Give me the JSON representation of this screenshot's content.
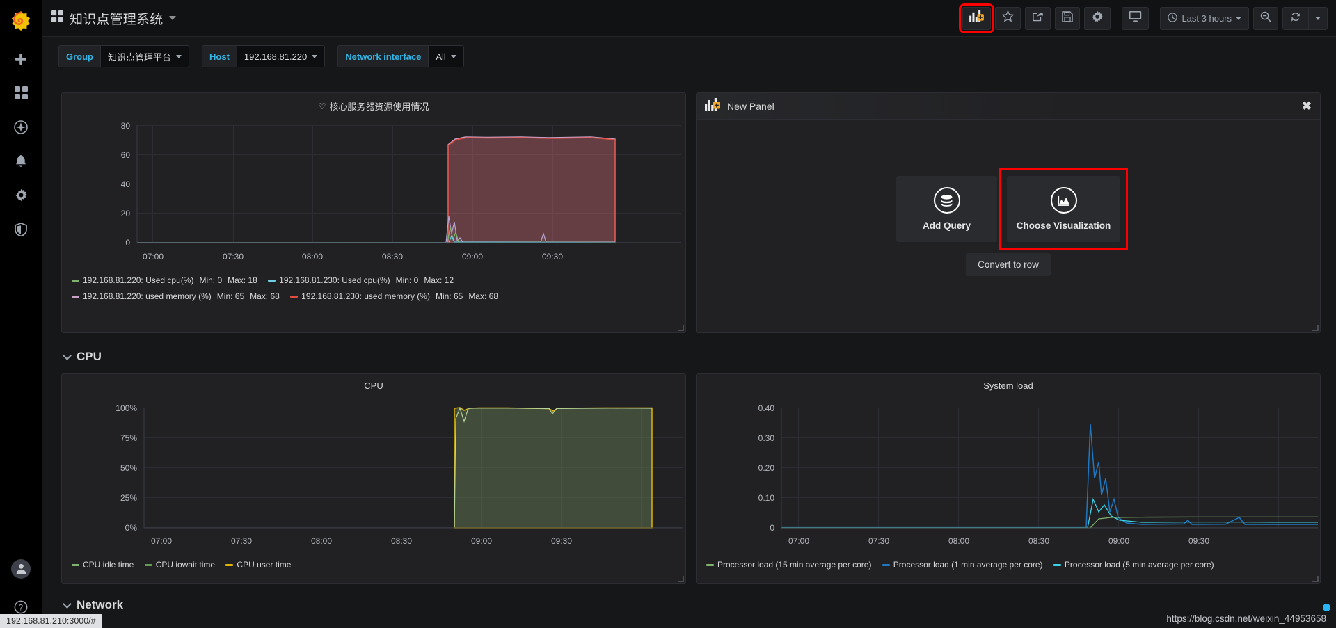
{
  "app": {
    "brand_icon": "grafana-logo-icon",
    "dashboard_title": "知识点管理系统",
    "dashboards_icon": "dashboards-icon"
  },
  "sidebar": {
    "items": [
      {
        "name": "create-icon",
        "label": "Create"
      },
      {
        "name": "dashboards-icon",
        "label": "Dashboards"
      },
      {
        "name": "explore-icon",
        "label": "Explore"
      },
      {
        "name": "alerting-bell-icon",
        "label": "Alerting"
      },
      {
        "name": "configuration-gear-icon",
        "label": "Configuration"
      },
      {
        "name": "shield-icon",
        "label": "Server Admin"
      }
    ],
    "bottom": [
      {
        "name": "user-avatar-icon",
        "label": "User"
      },
      {
        "name": "help-question-icon",
        "label": "Help"
      }
    ]
  },
  "toolbar": {
    "add_panel_label": "Add panel",
    "add_panel_icon": "add-panel-icon",
    "star_icon": "star-icon",
    "share_icon": "share-icon",
    "save_icon": "save-icon",
    "settings_icon": "gear-icon",
    "tv_icon": "tv-mode-icon",
    "time_icon": "clock-icon",
    "time_range": "Last 3 hours",
    "zoom_out_icon": "zoom-out-icon",
    "refresh_icon": "refresh-icon",
    "refresh_caret_icon": "chevron-down-icon",
    "highlight_color": "#ff0000"
  },
  "variables": [
    {
      "label": "Group",
      "value": "知识点管理平台"
    },
    {
      "label": "Host",
      "value": "192.168.81.220"
    },
    {
      "label": "Network interface",
      "value": "All"
    }
  ],
  "new_panel": {
    "title": "New Panel",
    "icon": "add-panel-icon",
    "close_icon": "close-icon",
    "add_query_label": "Add Query",
    "add_query_icon": "database-icon",
    "choose_viz_label": "Choose Visualization",
    "choose_viz_icon": "graph-visualization-icon",
    "convert_to_row_label": "Convert to row",
    "highlighted": "choose-visualization"
  },
  "rows": [
    {
      "label": "CPU"
    },
    {
      "label": "Network"
    }
  ],
  "status_bar": {
    "url": "192.168.81.210:3000/#"
  },
  "watermark": {
    "text": "https://blog.csdn.net/weixin_44953658"
  },
  "chart_data": [
    {
      "id": "core-server-resource",
      "type": "area",
      "title": "核心服务器资源使用情况",
      "title_icon": "heart-icon",
      "xlabel": "",
      "ylabel": "",
      "ylim": [
        0,
        80
      ],
      "yticks": [
        "0",
        "20",
        "40",
        "60",
        "80"
      ],
      "xticks": [
        "07:00",
        "07:30",
        "08:00",
        "08:30",
        "09:00",
        "09:30"
      ],
      "grid": true,
      "legend_position": "bottom",
      "series": [
        {
          "name": "192.168.81.220: Used cpu(%)",
          "color": "#7eb26d",
          "min": "0",
          "max": "18",
          "stat_min_label": "Min: 0",
          "stat_max_label": "Max: 18"
        },
        {
          "name": "192.168.81.230: Used cpu(%)",
          "color": "#6ed0e0",
          "min": "0",
          "max": "12",
          "stat_min_label": "Min: 0",
          "stat_max_label": "Max: 12"
        },
        {
          "name": "192.168.81.220: used memory (%)",
          "color": "#c8a2c8",
          "min": "65",
          "max": "68",
          "stat_min_label": "Min: 65",
          "stat_max_label": "Max: 68"
        },
        {
          "name": "192.168.81.230: used memory (%)",
          "color": "#e24d42",
          "min": "65",
          "max": "68",
          "stat_min_label": "Min: 65",
          "stat_max_label": "Max: 68"
        }
      ]
    },
    {
      "id": "cpu",
      "type": "area",
      "title": "CPU",
      "xlabel": "",
      "ylabel": "",
      "ylim": [
        0,
        100
      ],
      "yticks": [
        "0%",
        "25%",
        "50%",
        "75%",
        "100%"
      ],
      "xticks": [
        "07:00",
        "07:30",
        "08:00",
        "08:30",
        "09:00",
        "09:30"
      ],
      "grid": true,
      "legend_position": "bottom",
      "series": [
        {
          "name": "CPU idle time",
          "color": "#7eb26d"
        },
        {
          "name": "CPU iowait time",
          "color": "#629e51"
        },
        {
          "name": "CPU user time",
          "color": "#e0b400"
        }
      ]
    },
    {
      "id": "system-load",
      "type": "line",
      "title": "System load",
      "xlabel": "",
      "ylabel": "",
      "ylim": [
        0,
        0.4
      ],
      "yticks": [
        "0",
        "0.10",
        "0.20",
        "0.30",
        "0.40"
      ],
      "xticks": [
        "07:00",
        "07:30",
        "08:00",
        "08:30",
        "09:00",
        "09:30"
      ],
      "grid": true,
      "legend_position": "bottom",
      "series": [
        {
          "name": "Processor load (15 min average per core)",
          "color": "#7eb26d"
        },
        {
          "name": "Processor load (1 min average per core)",
          "color": "#1f78c1"
        },
        {
          "name": "Processor load (5 min average per core)",
          "color": "#3ad4e8"
        }
      ]
    }
  ]
}
